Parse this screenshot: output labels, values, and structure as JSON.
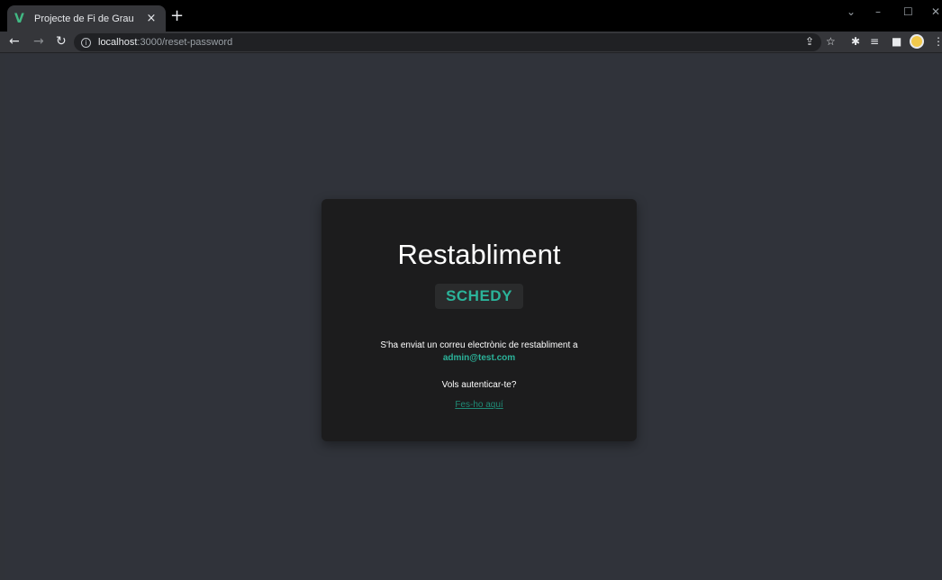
{
  "browser": {
    "tab_title": "Projecte de Fi de Grau",
    "tab_close": "×",
    "new_tab": "+",
    "url_host": "localhost",
    "url_path": ":3000/reset-password",
    "accent_color": "#41b883"
  },
  "card": {
    "title": "Restabliment",
    "brand": "SCHEDY",
    "message": "S'ha enviat un correu electrònic de restabliment a",
    "email": "admin@test.com",
    "question": "Vols autenticar-te?",
    "link": "Fes-ho aquí",
    "accent_color": "#2bb39a"
  }
}
